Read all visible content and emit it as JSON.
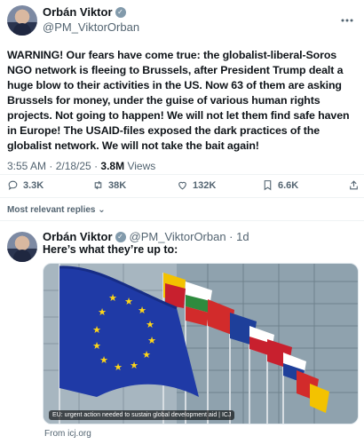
{
  "main_tweet": {
    "author_name": "Orbán Viktor",
    "handle": "@PM_ViktorOrban",
    "text": "WARNING! Our fears have come true: the globalist-liberal-Soros NGO network is fleeing to Brussels, after President Trump dealt a huge blow to their activities in the US. Now 63 of them are asking Brussels for money, under the guise of various human rights projects. Not going to happen! We will not let them find safe haven in Europe! The USAID-files exposed the dark practices of the globalist network. We will not take the bait again!",
    "time": "3:55 AM · 2/18/25 ·",
    "views_count": "3.8M",
    "views_label": "Views",
    "actions": {
      "replies": "3.3K",
      "retweets": "38K",
      "likes": "132K",
      "bookmarks": "6.6K"
    }
  },
  "replies_filter": "Most relevant replies",
  "reply": {
    "author_name": "Orbán Viktor",
    "handle_time": "@PM_ViktorOrban · 1d",
    "text": "Here’s what they’re up to:",
    "card": {
      "caption": "EU: urgent action needed to sustain global development aid | ICJ",
      "source": "From icj.org"
    }
  },
  "colors": {
    "eu_blue": "#1f3aa6",
    "eu_gold": "#ffd617",
    "secondary_text": "#536471"
  }
}
